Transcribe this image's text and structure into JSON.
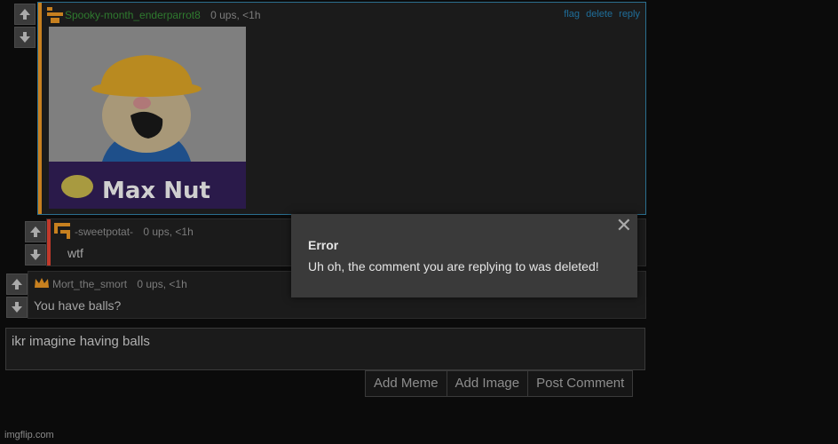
{
  "comments": [
    {
      "username": "Spooky-month_enderparrot8",
      "stats": "0 ups, <1h",
      "actions": [
        "flag",
        "delete",
        "reply"
      ],
      "meme_text": "Max  Nut",
      "accent_color": "#c7801f",
      "username_color": "#2f7a2f"
    },
    {
      "username": "-sweetpotat-",
      "stats": "0 ups, <1h",
      "text": "wtf",
      "accent_color": "#c0392b"
    },
    {
      "username": "Mort_the_smort",
      "stats": "0 ups, <1h",
      "text": "You have balls?",
      "accent_color": "#c0392b"
    }
  ],
  "reply_box": {
    "value": "ikr imagine having balls"
  },
  "buttons": {
    "add_meme": "Add Meme",
    "add_image": "Add Image",
    "post_comment": "Post Comment"
  },
  "modal": {
    "title": "Error",
    "message": "Uh oh, the comment you are replying to was deleted!",
    "close_icon": "close-icon"
  },
  "watermark": "imgflip.com"
}
